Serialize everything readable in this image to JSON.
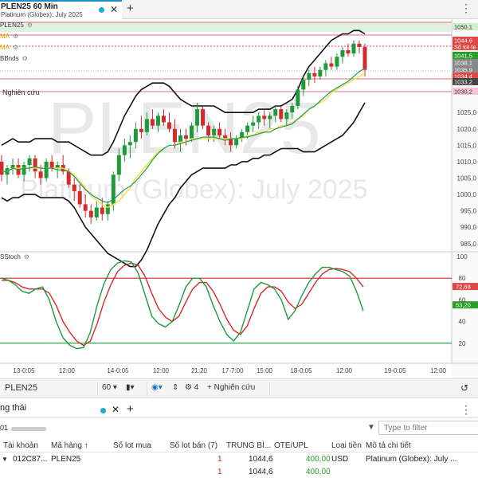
{
  "chart_tab": {
    "title": "PLEN25 60 Min",
    "subtitle": "Platinum (Globex): July 2025",
    "close": "✕",
    "add": "+",
    "menu": "⋮"
  },
  "legend": {
    "symbol": "PLEN25",
    "ma1": "MA",
    "ma2": "MA",
    "bbands": "BBnds",
    "research": "Nghiên cứu",
    "sstoch": "SStoch",
    "gear": "⚙"
  },
  "watermark": {
    "symbol": "PLEN25",
    "name": "Platinum (Globex): July 2025"
  },
  "price_axis": {
    "ticks": [
      "1025,0",
      "1020,0",
      "1015,0",
      "1010,0",
      "1005,0",
      "1000,0",
      "995,0",
      "990,0",
      "985,0"
    ],
    "tags": [
      {
        "label": "1050,1",
        "color": "#cfeccf"
      },
      {
        "label": "1044,6",
        "color": "#e04848"
      },
      {
        "label": "Số lot te",
        "color": "#e04848"
      },
      {
        "label": "1041,5",
        "color": "#2a9c2a"
      },
      {
        "label": "1038,1",
        "color": "#888888"
      },
      {
        "label": "1035,9",
        "color": "#888888"
      },
      {
        "label": "1034,4",
        "color": "#e04848"
      },
      {
        "label": "1033,2",
        "color": "#444444"
      },
      {
        "label": "1030,2",
        "color": "#f5c6d2"
      }
    ]
  },
  "stoch_axis": {
    "ticks": [
      "100",
      "80",
      "60",
      "40",
      "20"
    ],
    "tags": [
      {
        "label": "72,68",
        "color": "#e04848"
      },
      {
        "label": "53,20",
        "color": "#2a9c2a"
      }
    ]
  },
  "time_axis": [
    "13-0:05",
    "12:00",
    "14-0:05",
    "12:00",
    "21:20",
    "17-7:00",
    "15:00",
    "18-0:05",
    "12:00",
    "19-0:05",
    "12:00"
  ],
  "chart_data": {
    "type": "candlestick",
    "symbol": "PLEN25",
    "interval": "60 Min",
    "ylim": [
      983,
      1053
    ],
    "ohlc": [
      [
        1010,
        1012,
        1004,
        1006
      ],
      [
        1006,
        1009,
        1003,
        1008
      ],
      [
        1008,
        1011,
        1006,
        1009
      ],
      [
        1009,
        1011,
        1005,
        1006
      ],
      [
        1006,
        1010,
        1004,
        1009
      ],
      [
        1009,
        1012,
        1007,
        1011
      ],
      [
        1011,
        1012,
        1005,
        1007
      ],
      [
        1007,
        1009,
        1003,
        1005
      ],
      [
        1005,
        1011,
        1004,
        1010
      ],
      [
        1010,
        1012,
        1007,
        1008
      ],
      [
        1008,
        1010,
        1005,
        1009
      ],
      [
        1009,
        1012,
        1006,
        1007
      ],
      [
        1007,
        1008,
        1002,
        1003
      ],
      [
        1003,
        1005,
        998,
        1001
      ],
      [
        1001,
        1003,
        996,
        997
      ],
      [
        997,
        1000,
        993,
        995
      ],
      [
        995,
        997,
        991,
        993
      ],
      [
        993,
        998,
        992,
        996
      ],
      [
        996,
        999,
        992,
        994
      ],
      [
        994,
        998,
        992,
        997
      ],
      [
        997,
        1007,
        995,
        1006
      ],
      [
        1006,
        1014,
        1004,
        1012
      ],
      [
        1012,
        1017,
        1010,
        1015
      ],
      [
        1015,
        1018,
        1011,
        1016
      ],
      [
        1016,
        1022,
        1014,
        1020
      ],
      [
        1020,
        1024,
        1017,
        1019
      ],
      [
        1019,
        1025,
        1018,
        1023
      ],
      [
        1023,
        1026,
        1020,
        1021
      ],
      [
        1021,
        1025,
        1019,
        1024
      ],
      [
        1024,
        1026,
        1021,
        1022
      ],
      [
        1022,
        1025,
        1019,
        1020
      ],
      [
        1020,
        1023,
        1014,
        1016
      ],
      [
        1016,
        1020,
        1013,
        1018
      ],
      [
        1018,
        1020,
        1015,
        1017
      ],
      [
        1017,
        1022,
        1016,
        1021
      ],
      [
        1021,
        1028,
        1019,
        1026
      ],
      [
        1026,
        1027,
        1020,
        1021
      ],
      [
        1021,
        1022,
        1016,
        1018
      ],
      [
        1018,
        1021,
        1016,
        1020
      ],
      [
        1020,
        1022,
        1017,
        1018
      ],
      [
        1018,
        1020,
        1015,
        1017
      ],
      [
        1017,
        1019,
        1013,
        1015
      ],
      [
        1015,
        1018,
        1014,
        1017
      ],
      [
        1017,
        1020,
        1016,
        1019
      ],
      [
        1019,
        1022,
        1017,
        1021
      ],
      [
        1021,
        1024,
        1019,
        1022
      ],
      [
        1022,
        1025,
        1020,
        1024
      ],
      [
        1024,
        1026,
        1021,
        1023
      ],
      [
        1023,
        1025,
        1020,
        1024
      ],
      [
        1024,
        1027,
        1022,
        1026
      ],
      [
        1026,
        1027,
        1022,
        1023
      ],
      [
        1023,
        1026,
        1021,
        1025
      ],
      [
        1025,
        1028,
        1023,
        1027
      ],
      [
        1027,
        1033,
        1026,
        1032
      ],
      [
        1032,
        1036,
        1030,
        1035
      ],
      [
        1035,
        1038,
        1033,
        1037
      ],
      [
        1037,
        1039,
        1034,
        1036
      ],
      [
        1036,
        1039,
        1035,
        1038
      ],
      [
        1038,
        1041,
        1036,
        1040
      ],
      [
        1040,
        1042,
        1038,
        1039
      ],
      [
        1039,
        1043,
        1038,
        1042
      ],
      [
        1042,
        1045,
        1040,
        1044
      ],
      [
        1044,
        1046,
        1042,
        1043
      ],
      [
        1043,
        1047,
        1042,
        1046
      ],
      [
        1046,
        1047,
        1043,
        1045
      ],
      [
        1045,
        1046,
        1036,
        1038
      ]
    ],
    "ma": [
      1007,
      1007,
      1008,
      1008,
      1008,
      1008,
      1008,
      1008,
      1008,
      1008,
      1008,
      1008,
      1007,
      1006,
      1004,
      1002,
      1000,
      998,
      997,
      996,
      997,
      998,
      1000,
      1002,
      1005,
      1007,
      1009,
      1011,
      1013,
      1014,
      1015,
      1015,
      1016,
      1016,
      1017,
      1017,
      1017,
      1017,
      1017,
      1017,
      1017,
      1017,
      1017,
      1017,
      1018,
      1018,
      1019,
      1019,
      1020,
      1020,
      1021,
      1021,
      1022,
      1023,
      1024,
      1026,
      1027,
      1028,
      1029,
      1031,
      1032,
      1033,
      1034,
      1035,
      1036,
      1037
    ],
    "bb_upper": [
      1015,
      1016,
      1017,
      1016,
      1016,
      1016,
      1017,
      1017,
      1017,
      1017,
      1016,
      1016,
      1016,
      1015,
      1014,
      1013,
      1012,
      1012,
      1012,
      1013,
      1016,
      1020,
      1024,
      1027,
      1030,
      1032,
      1033,
      1034,
      1034,
      1034,
      1033,
      1031,
      1029,
      1028,
      1027,
      1027,
      1027,
      1027,
      1027,
      1026,
      1025,
      1025,
      1025,
      1025,
      1025,
      1025,
      1026,
      1026,
      1026,
      1027,
      1027,
      1028,
      1029,
      1032,
      1036,
      1039,
      1041,
      1043,
      1045,
      1047,
      1048,
      1049,
      1049,
      1050,
      1050,
      1049
    ],
    "bb_lower": [
      999,
      998,
      999,
      999,
      1000,
      1000,
      1000,
      999,
      999,
      999,
      999,
      999,
      998,
      996,
      993,
      990,
      988,
      986,
      984,
      982,
      981,
      980,
      979,
      978,
      978,
      980,
      983,
      987,
      991,
      994,
      997,
      999,
      1002,
      1004,
      1006,
      1007,
      1008,
      1008,
      1008,
      1008,
      1008,
      1009,
      1009,
      1010,
      1010,
      1011,
      1011,
      1012,
      1012,
      1013,
      1014,
      1014,
      1014,
      1014,
      1013,
      1013,
      1013,
      1014,
      1015,
      1016,
      1017,
      1018,
      1020,
      1022,
      1025,
      1028
    ],
    "stoch_k": [
      80,
      78,
      74,
      68,
      66,
      70,
      72,
      60,
      40,
      25,
      18,
      15,
      16,
      30,
      55,
      75,
      88,
      94,
      96,
      95,
      85,
      65,
      45,
      38,
      35,
      40,
      55,
      72,
      80,
      80,
      72,
      55,
      40,
      28,
      22,
      30,
      50,
      70,
      76,
      74,
      70,
      60,
      42,
      50,
      64,
      76,
      84,
      90,
      90,
      88,
      86,
      82,
      68,
      50
    ],
    "stoch_d": [
      78,
      78,
      76,
      72,
      70,
      70,
      70,
      66,
      55,
      40,
      30,
      22,
      18,
      22,
      38,
      58,
      74,
      86,
      92,
      94,
      92,
      82,
      66,
      52,
      44,
      40,
      45,
      58,
      70,
      76,
      76,
      68,
      56,
      42,
      32,
      28,
      36,
      52,
      66,
      72,
      72,
      68,
      58,
      52,
      56,
      66,
      76,
      84,
      88,
      89,
      88,
      86,
      80,
      72
    ],
    "overbought": 80,
    "oversold": 20
  },
  "toolbar": {
    "symbol": "PLEN25",
    "interval": "60",
    "draw_count": "4",
    "research": "Nghiên cứu",
    "refresh": "↺"
  },
  "panel": {
    "tab_label": "ng thái",
    "account_prefix": "01",
    "filter_placeholder": "Type to filter",
    "columns": [
      "Tài khoản",
      "Mã hàng",
      "Số lot mua",
      "Số lot bán (7)",
      "TRUNG BÌ...",
      "OTE/UPL",
      "Loại tiền",
      "Mô tả chi tiết"
    ],
    "rows": [
      {
        "account": "012C87...",
        "symbol": "PLEN25",
        "buy": "",
        "sell": "1",
        "avg": "1044,6",
        "ote": "400,00",
        "currency": "USD",
        "desc": "Platinum (Globex): July ..."
      },
      {
        "account": "",
        "symbol": "",
        "buy": "",
        "sell": "1",
        "avg": "1044,6",
        "ote": "400,00",
        "currency": "",
        "desc": ""
      }
    ]
  }
}
